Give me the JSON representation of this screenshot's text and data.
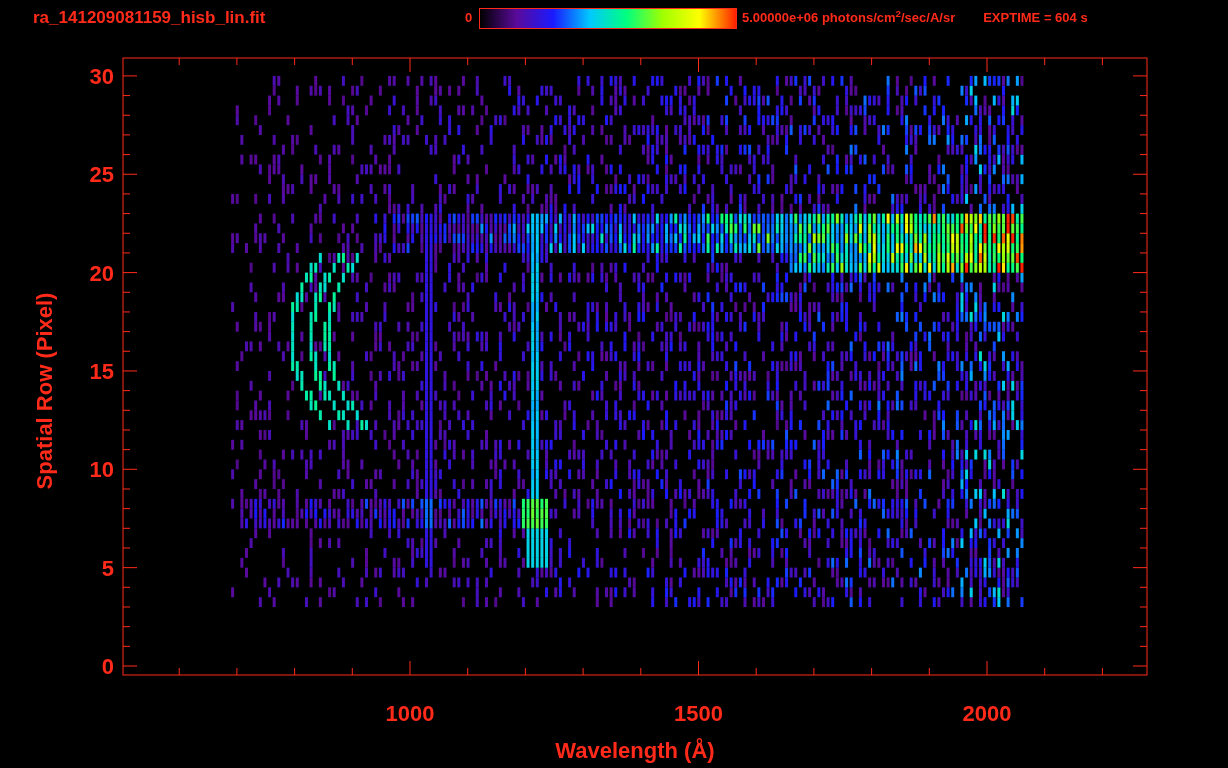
{
  "header": {
    "file_name": "ra_141209081159_hisb_lin.fit",
    "colorbar_min": "0",
    "colorbar_max": "5.00000e+06 photons/cm$^{2}$/sec/A/sr",
    "exposure": "EXPTIME = 604 s"
  },
  "plot": {
    "xlabel": "Wavelength (Å)",
    "ylabel": "Spatial Row (Pixel)",
    "xticks": [
      "1000",
      "1500",
      "2000"
    ],
    "yticks": [
      "30",
      "25",
      "20",
      "15",
      "10",
      "5",
      "0"
    ]
  }
}
